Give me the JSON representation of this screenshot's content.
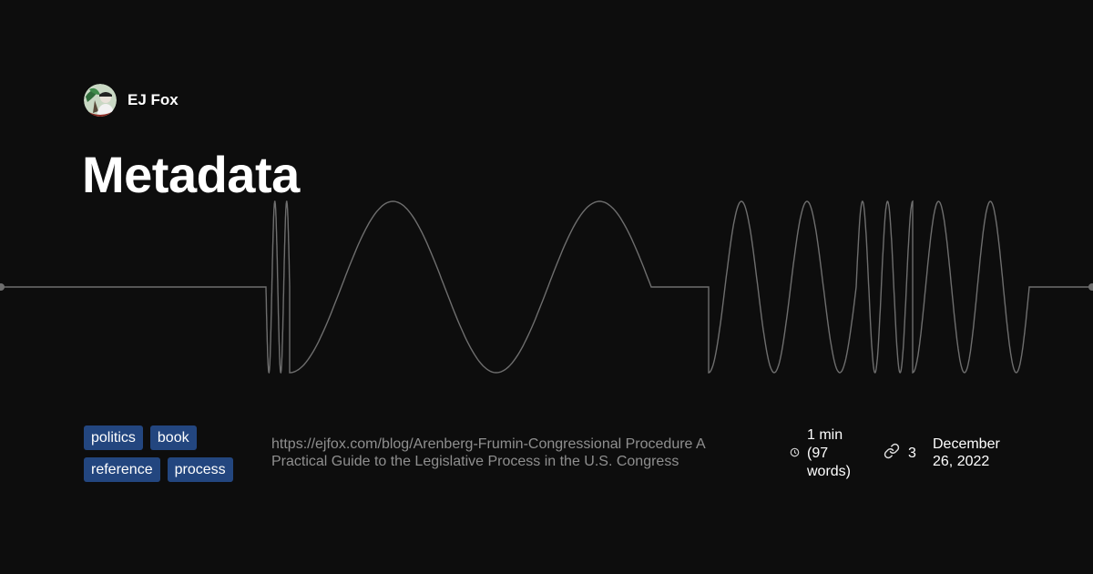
{
  "author": {
    "name": "EJ Fox"
  },
  "post": {
    "title": "Metadata",
    "url": "https://ejfox.com/blog/Arenberg-Frumin-Congressional Procedure A Practical Guide to the Legislative Process in the U.S. Congress",
    "reading_time": "1 min (97 words)",
    "link_count": "3",
    "date": "December 26, 2022"
  },
  "tags": [
    "politics",
    "book",
    "reference",
    "process"
  ],
  "icons": {
    "reading_time": "clock-icon",
    "links": "link-icon"
  },
  "colors": {
    "background": "#0d0d0d",
    "tag_background": "#23467f",
    "waveform": "#6e6e6e",
    "url_text": "#8f8f8f"
  }
}
